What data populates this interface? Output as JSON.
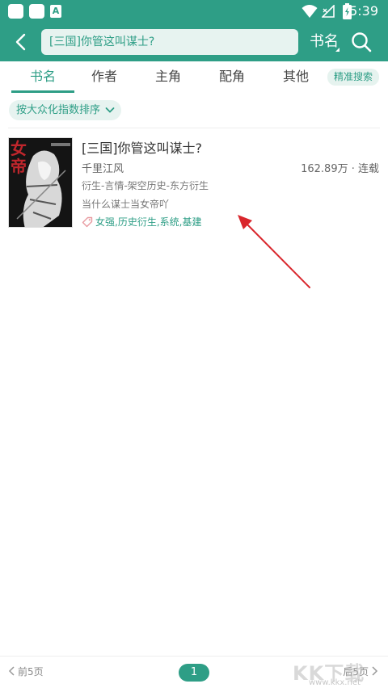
{
  "status_bar": {
    "time": "5:39",
    "notice_icon_letter": "A"
  },
  "header": {
    "search_value": "[三国]你管这叫谋士?",
    "search_type": "书名"
  },
  "tabs": [
    "书名",
    "作者",
    "主角",
    "配角",
    "其他"
  ],
  "active_tab": "书名",
  "precise_search_label": "精准搜索",
  "sort_label": "按大众化指数排序",
  "results": [
    {
      "title": "[三国]你管这叫谋士?",
      "author": "千里江风",
      "word_count_status": "162.89万 · 连载",
      "categories": "衍生-言情-架空历史-东方衍生",
      "description": "当什么谋士当女帝吖",
      "tags": "女强,历史衍生,系统,基建",
      "cover_text": "女帝"
    }
  ],
  "pagination": {
    "prev_label": "前5页",
    "current_page": "1",
    "next_label": "后5页"
  },
  "watermark": {
    "brand": "KK下载",
    "url": "www.kkx.net"
  },
  "colors": {
    "accent": "#2e9e86",
    "arrow": "#d9262c"
  }
}
